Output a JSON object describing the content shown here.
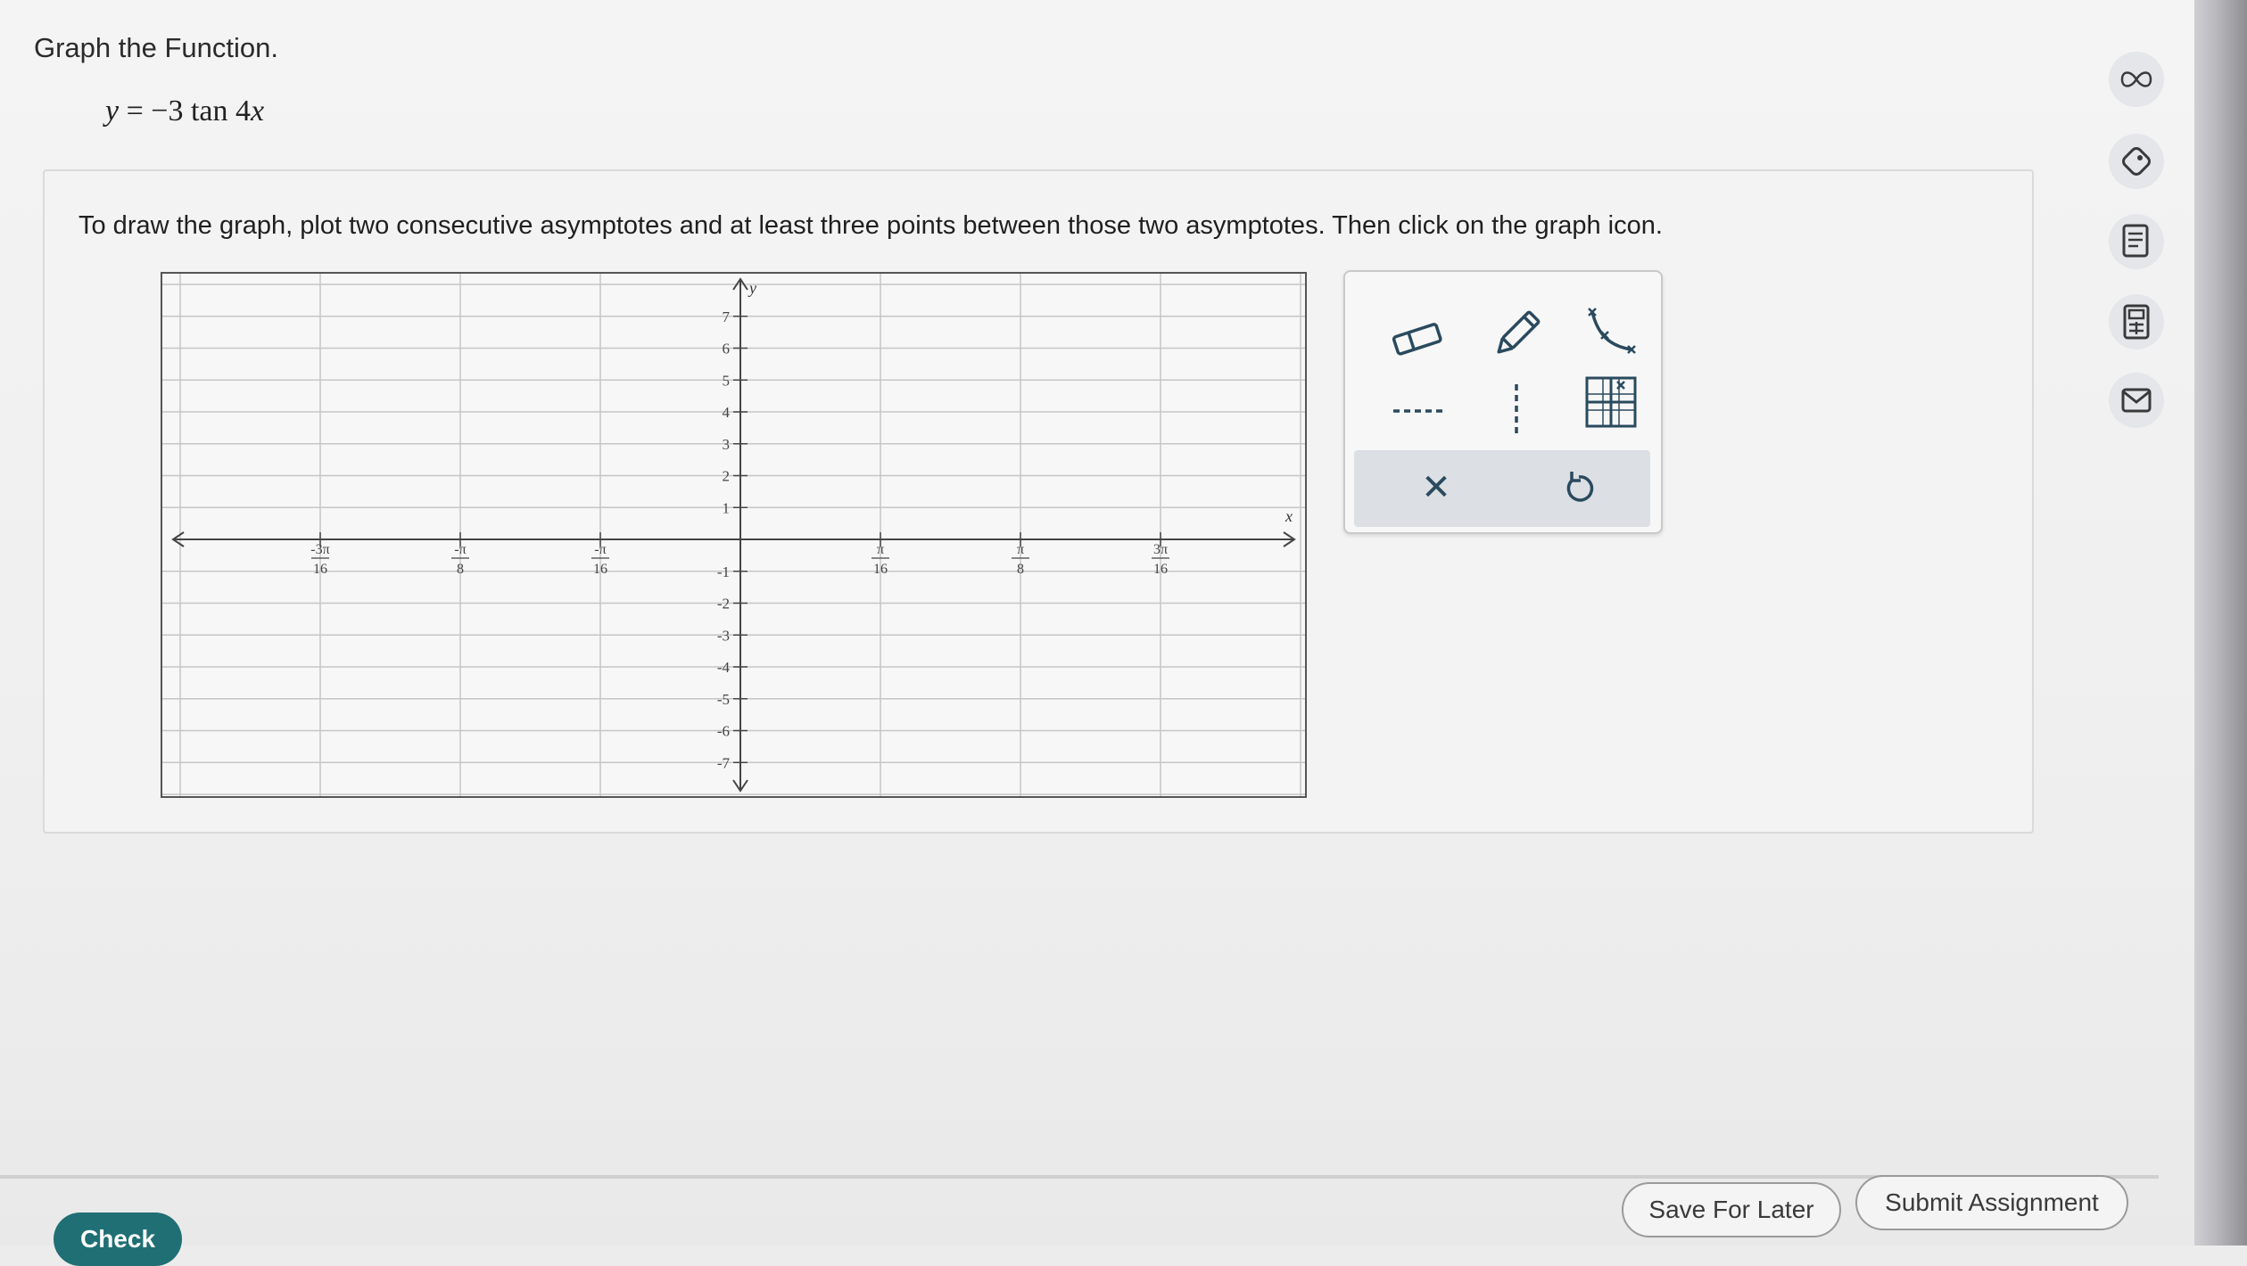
{
  "question": {
    "prompt": "Graph the Function.",
    "equation_lhs": "y",
    "equation_rhs": "= −3 tan 4",
    "equation_var": "x"
  },
  "instructions": "To draw the graph, plot two consecutive asymptotes and at least three points between those two asymptotes. Then click on the graph icon.",
  "graph": {
    "x_axis_label": "x",
    "y_axis_label": "y",
    "x_ticks": [
      {
        "num": "-3π",
        "den": "16"
      },
      {
        "num": "-π",
        "den": "8"
      },
      {
        "num": "-π",
        "den": "16"
      },
      {
        "num": "π",
        "den": "16"
      },
      {
        "num": "π",
        "den": "8"
      },
      {
        "num": "3π",
        "den": "16"
      }
    ],
    "y_ticks_positive": [
      "7",
      "6",
      "5",
      "4",
      "3",
      "2",
      "1"
    ],
    "y_ticks_negative": [
      "-1",
      "-2",
      "-3",
      "-4",
      "-5",
      "-6",
      "-7"
    ],
    "y_range": [
      -8,
      8
    ],
    "x_range_sixteenths_of_pi": [
      -4,
      4
    ]
  },
  "tools": {
    "eraser": "eraser-icon",
    "pencil": "pencil-icon",
    "curve": "tangent-curve-icon",
    "horizontal_asymptote": "horizontal-dashed-line-icon",
    "vertical_asymptote": "vertical-dashed-line-icon",
    "point_grid": "point-grid-icon",
    "clear": "✕",
    "undo": "↺"
  },
  "side_icons": [
    "infinity-icon",
    "tag-icon",
    "notes-icon",
    "calculator-icon",
    "mail-icon"
  ],
  "footer": {
    "check_label": "Check",
    "save_label": "Save For Later",
    "submit_label": "Submit Assignment"
  },
  "colors": {
    "check_button": "#1f6f74",
    "tool_icon": "#2a4a5e"
  }
}
